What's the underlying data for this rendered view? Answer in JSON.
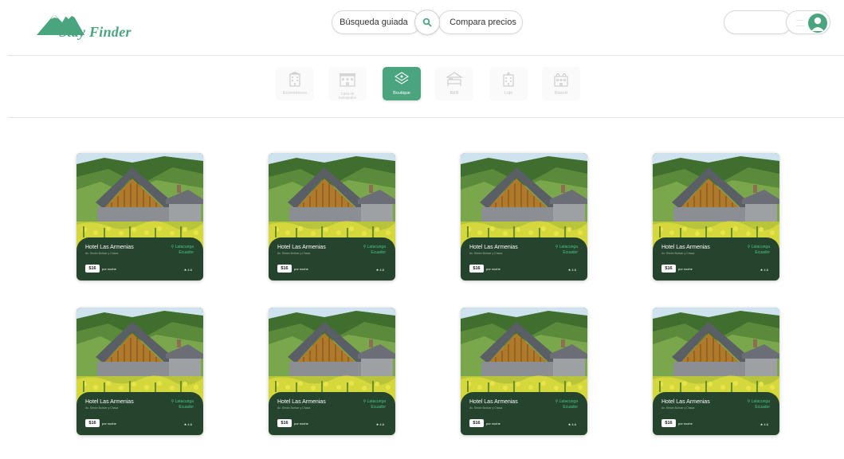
{
  "brand": {
    "name": "Stay Finder",
    "color": "#4aa57f"
  },
  "search": {
    "guided_label": "Búsqueda guiada",
    "compare_label": "Compara precios",
    "icon": "search-icon"
  },
  "user": {
    "input_placeholder": "",
    "menu_icon": "menu-icon",
    "avatar_icon": "user-avatar-icon"
  },
  "categories": [
    {
      "label": "Económicos",
      "icon": "building-icon",
      "active": false
    },
    {
      "label": "Casa de huéspedes",
      "icon": "guesthouse-icon",
      "active": false
    },
    {
      "label": "Boutique",
      "icon": "boutique-icon",
      "active": true
    },
    {
      "label": "B&B",
      "icon": "bed-breakfast-icon",
      "active": false
    },
    {
      "label": "Lujo",
      "icon": "luxury-hotel-icon",
      "active": false
    },
    {
      "label": "Resort",
      "icon": "resort-icon",
      "active": false
    }
  ],
  "cards": [
    {
      "name": "Hotel Las Armenias",
      "subtitle": "Av. Simón Bolívar y Chaca",
      "location_city": "Latacunga",
      "location_country": "Ecuador",
      "price": "$16",
      "per": "por noche",
      "rating": "★ 4.6"
    },
    {
      "name": "Hotel Las Armenias",
      "subtitle": "Av. Simón Bolívar y Chaca",
      "location_city": "Latacunga",
      "location_country": "Ecuador",
      "price": "$16",
      "per": "por noche",
      "rating": "★ 4.6"
    },
    {
      "name": "Hotel Las Armenias",
      "subtitle": "Av. Simón Bolívar y Chaca",
      "location_city": "Latacunga",
      "location_country": "Ecuador",
      "price": "$16",
      "per": "por noche",
      "rating": "★ 4.6"
    },
    {
      "name": "Hotel Las Armenias",
      "subtitle": "Av. Simón Bolívar y Chaca",
      "location_city": "Latacunga",
      "location_country": "Ecuador",
      "price": "$16",
      "per": "por noche",
      "rating": "★ 4.6"
    },
    {
      "name": "Hotel Las Armenias",
      "subtitle": "Av. Simón Bolívar y Chaca",
      "location_city": "Latacunga",
      "location_country": "Ecuador",
      "price": "$16",
      "per": "por noche",
      "rating": "★ 4.6"
    },
    {
      "name": "Hotel Las Armenias",
      "subtitle": "Av. Simón Bolívar y Chaca",
      "location_city": "Latacunga",
      "location_country": "Ecuador",
      "price": "$16",
      "per": "por noche",
      "rating": "★ 4.6"
    },
    {
      "name": "Hotel Las Armenias",
      "subtitle": "Av. Simón Bolívar y Chaca",
      "location_city": "Latacunga",
      "location_country": "Ecuador",
      "price": "$16",
      "per": "por noche",
      "rating": "★ 4.6"
    },
    {
      "name": "Hotel Las Armenias",
      "subtitle": "Av. Simón Bolívar y Chaca",
      "location_city": "Latacunga",
      "location_country": "Ecuador",
      "price": "$16",
      "per": "por noche",
      "rating": "★ 4.6"
    }
  ]
}
